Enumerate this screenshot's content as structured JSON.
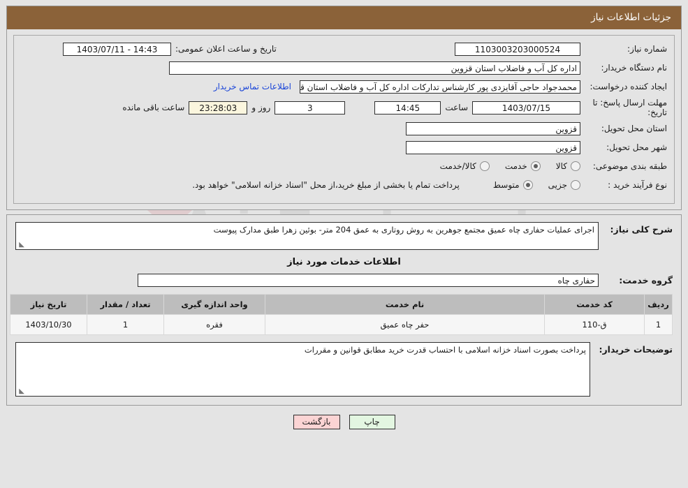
{
  "header": {
    "title": "جزئیات اطلاعات نیاز"
  },
  "form": {
    "need_number_label": "شماره نیاز:",
    "need_number": "1103003203000524",
    "public_announce_label": "تاریخ و ساعت اعلان عمومی:",
    "public_announce_value": "14:43 - 1403/07/11",
    "buyer_org_label": "نام دستگاه خریدار:",
    "buyer_org": "اداره کل آب و فاضلاب استان قزوین",
    "creator_label": "ایجاد کننده درخواست:",
    "creator": "محمدجواد حاجی آقایزدی پور کارشناس تدارکات اداره کل آب و فاضلاب استان قزو",
    "contact_link": "اطلاعات تماس خریدار",
    "deadline_label": "مهلت ارسال پاسخ: تا تاریخ:",
    "deadline_date": "1403/07/15",
    "hour_word": "ساعت",
    "deadline_time": "14:45",
    "days_remaining": "3",
    "days_word": "روز و",
    "countdown": "23:28:03",
    "remaining_word": "ساعت باقی مانده",
    "province_label": "استان محل تحویل:",
    "province": "قزوین",
    "city_label": "شهر محل تحویل:",
    "city": "قزوین",
    "category_label": "طبقه بندی موضوعی:",
    "category_options": [
      "کالا",
      "خدمت",
      "کالا/خدمت"
    ],
    "category_selected": "خدمت",
    "purchase_type_label": "نوع فرآیند خرید :",
    "purchase_type_options": [
      "جزیی",
      "متوسط"
    ],
    "purchase_type_selected": "متوسط",
    "payment_note": "پرداخت تمام یا بخشی از مبلغ خرید،از محل \"اسناد خزانه اسلامی\" خواهد بود."
  },
  "description": {
    "label": "شرح کلی نیاز:",
    "text": "اجرای عملیات حفاری چاه عمیق مجتمع جوهرین به روش روتاری به عمق 204 متر-  بوئین زهرا طبق مدارک پیوست"
  },
  "services": {
    "heading": "اطلاعات خدمات مورد نیاز",
    "group_label": "گروه خدمت:",
    "group_value": "حفاری چاه",
    "table": {
      "columns": [
        "ردیف",
        "کد خدمت",
        "نام خدمت",
        "واحد اندازه گیری",
        "تعداد / مقدار",
        "تاریخ نیاز"
      ],
      "rows": [
        {
          "row_no": "1",
          "service_code": "ق-110",
          "service_name": "حفر چاه عمیق",
          "unit": "فقره",
          "quantity": "1",
          "need_date": "1403/10/30"
        }
      ]
    }
  },
  "buyer_notes": {
    "label": "توضیحات خریدار:",
    "text": "پرداخت بصورت اسناد خزانه اسلامی با احتساب قدرت خرید مطابق قوانین و مقررات"
  },
  "buttons": {
    "print": "چاپ",
    "back": "بازگشت"
  },
  "watermark": {
    "text": "AriaTender.net"
  }
}
